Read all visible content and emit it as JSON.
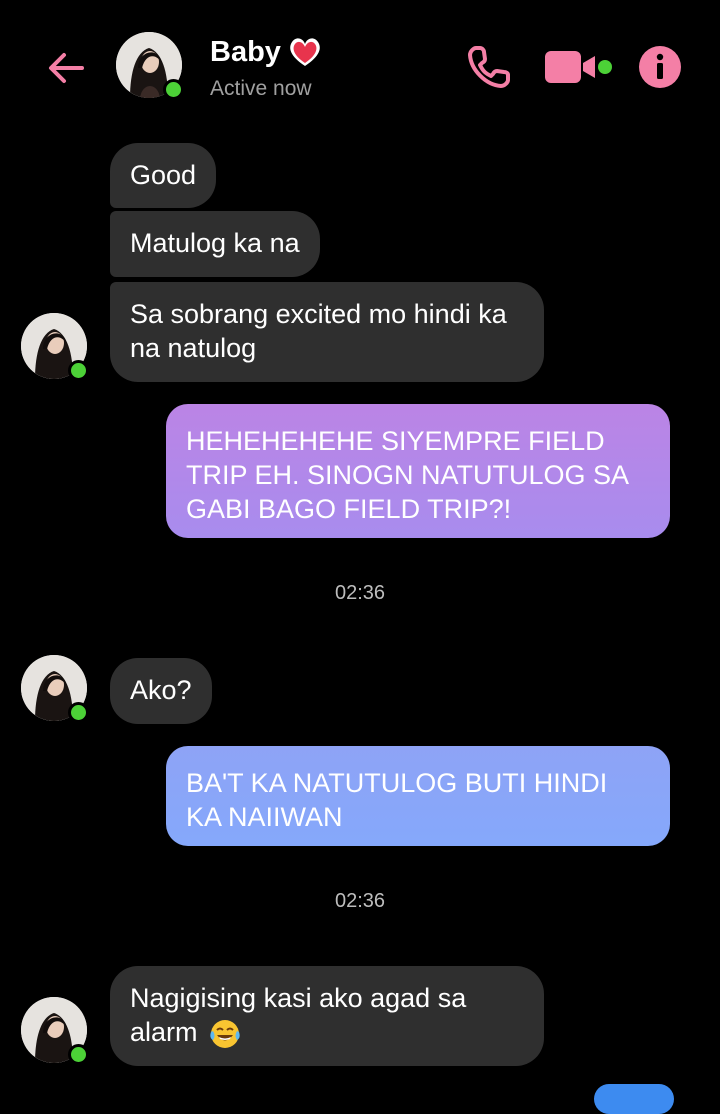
{
  "header": {
    "name": "Baby",
    "status": "Active now",
    "icons": {
      "back": "back-arrow-icon",
      "heart": "heart-emoji-icon",
      "call": "phone-icon",
      "video": "video-camera-icon",
      "info": "info-icon"
    }
  },
  "colors": {
    "accent": "#f47fa6",
    "incoming_bubble": "#2f2f2f",
    "outgoing_gradient_purple": "#b47ee3",
    "outgoing_gradient_blue": "#87a4f8",
    "online": "#4cd137"
  },
  "messages": [
    {
      "from": "contact",
      "text": "Good"
    },
    {
      "from": "contact",
      "text": "Matulog ka na"
    },
    {
      "from": "contact",
      "text": "Sa sobrang excited mo hindi ka na natulog"
    },
    {
      "from": "me",
      "text": "HEHEHEHEHE SIYEMPRE FIELD TRIP EH. SINOGN NATUTULOG SA GABI BAGO FIELD TRIP?!"
    },
    {
      "type": "timestamp",
      "text": "02:36"
    },
    {
      "from": "contact",
      "text": "Ako?"
    },
    {
      "from": "me",
      "text": "BA'T KA NATUTULOG BUTI HINDI KA NAIIWAN"
    },
    {
      "type": "timestamp",
      "text": "02:36"
    },
    {
      "from": "contact",
      "text": "Nagigising kasi ako agad sa alarm",
      "emoji": "laughing-tears-emoji"
    }
  ]
}
